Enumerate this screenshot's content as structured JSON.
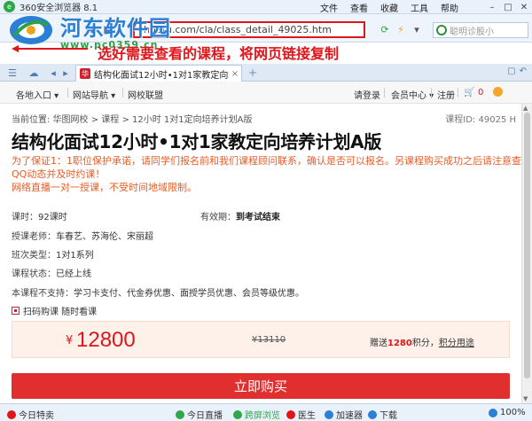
{
  "browser": {
    "title": "360安全浏览器 8.1",
    "menus": [
      "文件",
      "查看",
      "收藏",
      "工具",
      "帮助"
    ],
    "url_text": "huatu.com/cla/class_detail_49025.htm",
    "search_placeholder": "聪明诊股小",
    "tab_label": "结构化面试12小时•1对1家教定向培养计划A版",
    "tab_close": "×",
    "tab_add": "+"
  },
  "watermark": {
    "title": "河东软件园",
    "url": "www.pc0359.cn"
  },
  "annotation": "选好需要查看的课程，将网页链接复制",
  "sitenav": {
    "entry": "各地入口",
    "site_nav": "网站导航",
    "alliance": "网校联盟",
    "login": "请登录",
    "member": "会员中心",
    "register": "注册",
    "cart_count": "0"
  },
  "page": {
    "breadcrumb": "当前位置:  华图网校  >  课程  >  12小时  1对1定向培养计划A版",
    "class_id": "课程ID: 49025 H",
    "title": "结构化面试12小时•1对1家教定向培养计划A版",
    "notice_lines": [
      "为了保证1：1职位保护承诺，请同学们报名前和我们课程顾问联系，确认是否可以报名。另课程购买成功之后请注意查看",
      "QQ动态并及时约课！",
      "网络直播一对一授课，不受时间地域限制。"
    ],
    "hours_label": "课时：",
    "hours_value": "92课时",
    "validity_label": "有效期：",
    "validity_value": "到考试结束",
    "teacher_label": "授课老师：",
    "teacher_value": "车春艺、苏海伦、宋丽超",
    "series_label": "班次类型：",
    "series_value": "1对1系列",
    "status_label": "课程状态：",
    "status_value": "已经上线",
    "unsupported_label": "本课程不支持：",
    "unsupported_value": "学习卡支付、代金券优惠、面授学员优惠、会员等级优惠。",
    "qr_text": "扫码购课 随时看课",
    "currency": "¥",
    "price": "12800",
    "original_price": "¥13110",
    "bonus_prefix": "赠送",
    "bonus_points": "1280",
    "bonus_suffix": "积分，",
    "bonus_link": "积分用途",
    "buy_button": "立即购买"
  },
  "statusbar": {
    "today": "今日特卖",
    "live": "今日直播",
    "fast": "跨屏浏览",
    "doctor": "医生",
    "accelerator": "加速器",
    "download": "下载",
    "zoom": "100%"
  },
  "colors": {
    "accent_red": "#e0151a",
    "notice_orange": "#e95c26",
    "watermark_blue": "#2a7fd6",
    "watermark_green": "#2ea04a"
  }
}
